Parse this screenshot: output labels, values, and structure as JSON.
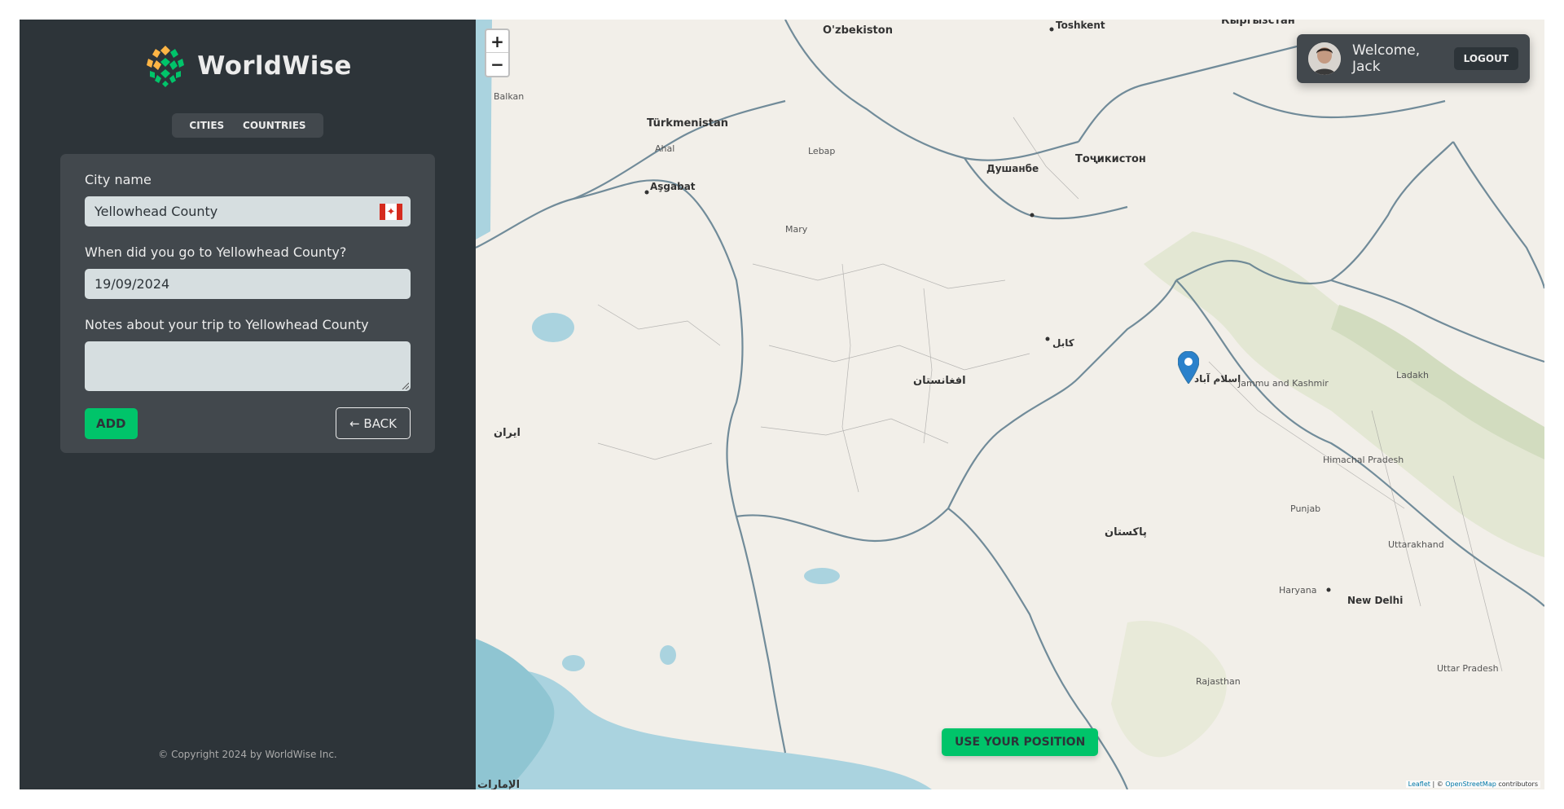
{
  "app": {
    "name": "WorldWise"
  },
  "tabs": [
    "Cities",
    "Countries"
  ],
  "form": {
    "city_label": "City name",
    "city_value": "Yellowhead County",
    "date_label": "When did you go to Yellowhead County?",
    "date_value": "19/09/2024",
    "notes_label": "Notes about your trip to Yellowhead County",
    "notes_value": "",
    "add_label": "Add",
    "back_label": "← BACK",
    "flag": "🇨🇦"
  },
  "footer": "© Copyright 2024 by WorldWise Inc.",
  "user": {
    "welcome": "Welcome, Jack",
    "logout": "LOGOUT"
  },
  "map": {
    "zoom_in": "+",
    "zoom_out": "−",
    "use_position": "USE YOUR POSITION",
    "attribution_leaflet": "Leaflet",
    "attribution_sep": " | © ",
    "attribution_osm": "OpenStreetMap",
    "attribution_tail": " contributors",
    "labels": {
      "uzbekistan": "O'zbekiston",
      "toshkent": "Toshkent",
      "kyrgyzstan": "Кыргызстан",
      "turkmenistan": "Türkmenistan",
      "ashgabat": "Aşgabat",
      "dushanbe": "Душанбе",
      "tajikistan": "Тоҷикистон",
      "afghanistan": "افغانستان",
      "kabul": "کابل",
      "islamabad": "اسلام آباد",
      "pakistan": "پاکستان",
      "iran": "ایران",
      "new_delhi": "New Delhi",
      "ladakh": "Ladakh",
      "jammu_kashmir": "Jammu and Kashmir",
      "himachal": "Himachal Pradesh",
      "punjab": "Punjab",
      "uttarakhand": "Uttarakhand",
      "haryana": "Haryana",
      "rajasthan": "Rajasthan",
      "uttar_pradesh": "Uttar Pradesh",
      "balkan": "Balkan",
      "ahal": "Ahal",
      "mary": "Mary",
      "lebap": "Lebap",
      "uae": "الإمارات"
    }
  },
  "colors": {
    "dark1": "#2d3439",
    "dark2": "#42484d",
    "brand": "#00c46a",
    "light": "#d6dee0",
    "text": "#ececec"
  }
}
